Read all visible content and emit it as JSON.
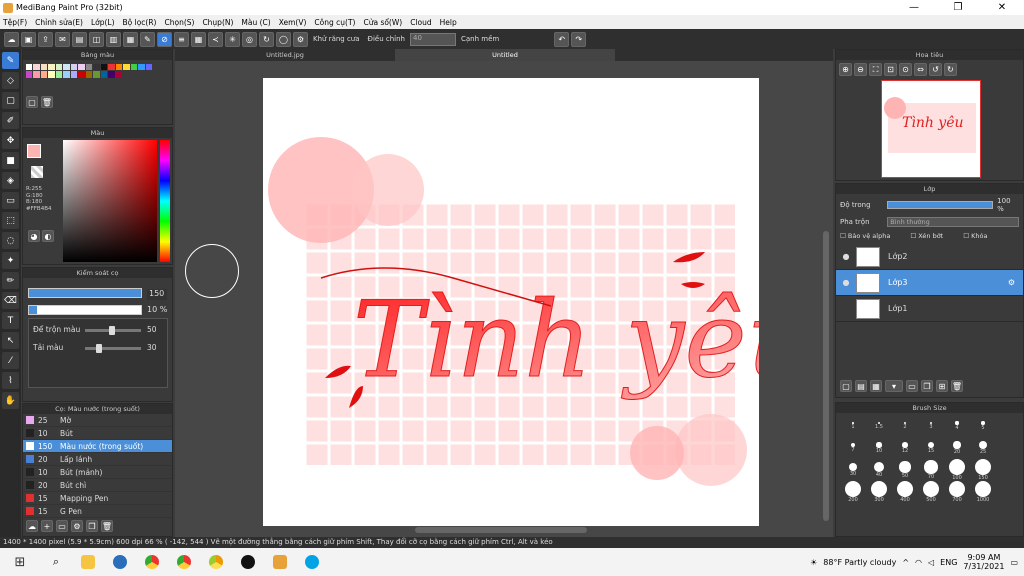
{
  "app": {
    "title": "MediBang Paint Pro (32bit)",
    "min": "—",
    "max": "❐",
    "close": "✕"
  },
  "menu": [
    "Tệp(F)",
    "Chỉnh sửa(E)",
    "Lớp(L)",
    "Bộ lọc(R)",
    "Chọn(S)",
    "Chụp(N)",
    "Màu (C)",
    "Xem(V)",
    "Công cụ(T)",
    "Cửa sổ(W)",
    "Cloud",
    "Help"
  ],
  "toolbar": {
    "antialias_label": "Khử răng cưa",
    "adjust_label": "Điều chỉnh",
    "adjust_value": "40",
    "snap_label": "Cạnh mềm"
  },
  "panels": {
    "swatch": "Bảng màu",
    "color": "Màu",
    "brush_control": "Kiểm soát cọ",
    "brush_list": "Cọ: Màu nước (trong suốt)",
    "navigator": "Hoa tiêu",
    "layers": "Lớp",
    "brush_size": "Brush Size"
  },
  "color": {
    "r": "R:255",
    "g": "G:180",
    "b": "B:180",
    "hex": "#FFB4B4",
    "fg": "#ffb4b4"
  },
  "brush": {
    "size": "150",
    "opacity": "10 %",
    "blend_label": "Để trộn màu",
    "blend_value": "50",
    "refill_label": "Tải màu",
    "refill_value": "30"
  },
  "brushes": [
    {
      "size": "25",
      "name": "Mờ",
      "color": "#e9a8f0"
    },
    {
      "size": "10",
      "name": "Bút",
      "color": "#222"
    },
    {
      "size": "150",
      "name": "Màu nước (trong suốt)",
      "color": "#ffffff"
    },
    {
      "size": "20",
      "name": "Lấp lánh",
      "color": "#4a7fd6"
    },
    {
      "size": "10",
      "name": "Bút (mảnh)",
      "color": "#222"
    },
    {
      "size": "20",
      "name": "Bút chì",
      "color": "#222"
    },
    {
      "size": "15",
      "name": "Mapping Pen",
      "color": "#e03030"
    },
    {
      "size": "15",
      "name": "G Pen",
      "color": "#e03030"
    }
  ],
  "tabs": [
    "Untitled.jpg",
    "Untitled"
  ],
  "artwork_text": "Tình yêu",
  "layers_panel": {
    "opacity_label": "Độ trong",
    "opacity_value": "100 %",
    "blend_label": "Pha trộn",
    "blend_value": "Bình thường",
    "protect_alpha": "Bảo vệ alpha",
    "clip": "Xén bớt",
    "lock": "Khóa"
  },
  "layers": [
    {
      "name": "Lớp2"
    },
    {
      "name": "Lớp3"
    },
    {
      "name": "Lớp1"
    }
  ],
  "brush_sizes": [
    "1",
    "1.5",
    "2",
    "3",
    "4",
    "5",
    "7",
    "10",
    "12",
    "15",
    "20",
    "25",
    "30",
    "40",
    "50",
    "70",
    "100",
    "150",
    "200",
    "300",
    "400",
    "500",
    "700",
    "1000"
  ],
  "status": "1400 * 1400 pixel   (5.9 * 5.9cm)   600 dpi   66 %   ( -142, 544 )   Vẽ một đường thẳng bằng cách giữ phím Shift, Thay đổi cỡ cọ bằng cách giữ phím Ctrl, Alt và kéo",
  "taskbar": {
    "weather": "88°F  Partly cloudy",
    "lang": "ENG",
    "time": "9:09 AM",
    "date": "7/31/2021"
  }
}
